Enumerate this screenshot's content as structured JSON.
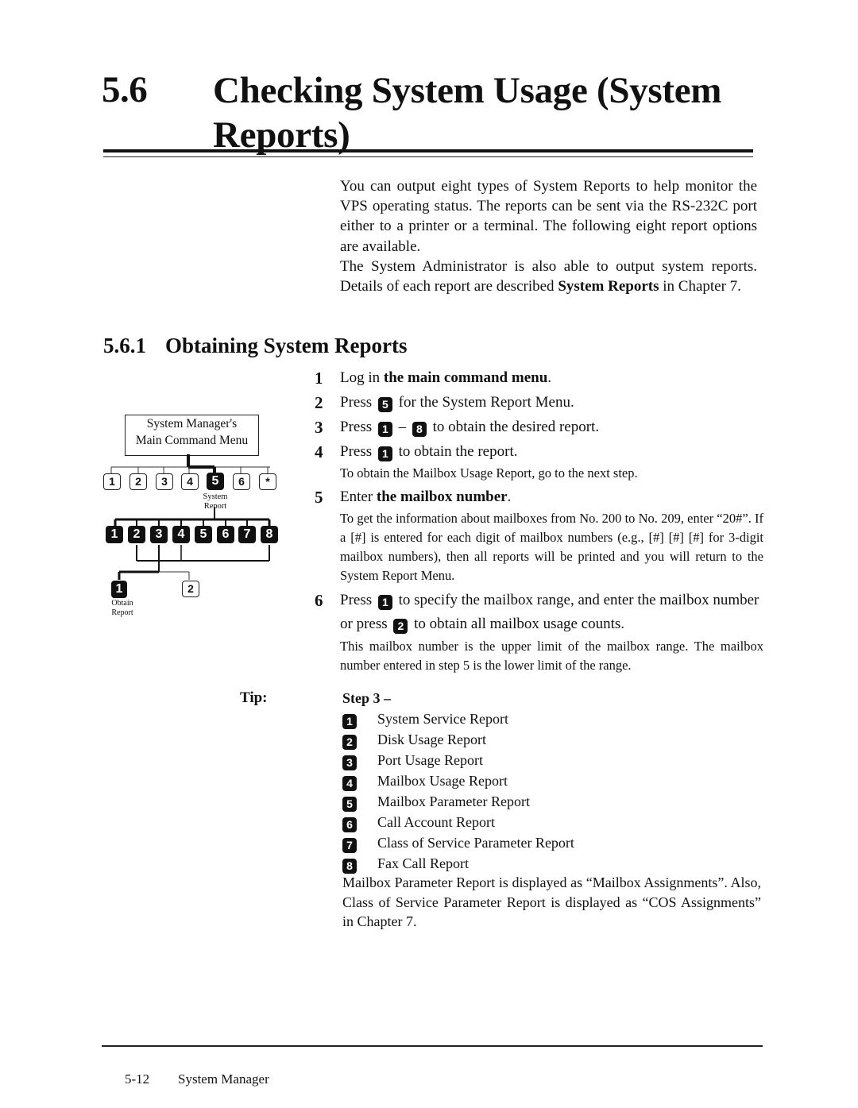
{
  "section": {
    "number": "5.6",
    "title": "Checking System Usage (System Reports)"
  },
  "intro": {
    "p1": "You can output eight types of System Reports to help monitor the VPS operating status. The reports can be sent via the RS-232C port either to a printer or a terminal. The following eight report options are available.",
    "p2_pre": "The System Administrator is also able to output system reports. Details of each report are described ",
    "p2_bold": "System Reports",
    "p2_post": " in Chapter 7."
  },
  "subsection": {
    "number": "5.6.1",
    "title": "Obtaining System Reports"
  },
  "diagram": {
    "menu_box": [
      "System Manager's",
      "Main Command Menu"
    ],
    "top_keys": [
      "1",
      "2",
      "3",
      "4",
      "5",
      "6",
      "*"
    ],
    "selected_top_key": "5",
    "system_report_label": [
      "System",
      "Report"
    ],
    "report_keys": [
      "1",
      "2",
      "3",
      "4",
      "5",
      "6",
      "7",
      "8"
    ],
    "sub_keys": [
      "1",
      "2"
    ],
    "obtain_label": [
      "Obtain",
      "Report"
    ]
  },
  "steps": [
    {
      "n": "1",
      "pre": "Log in ",
      "bold": "the main command menu",
      "post": "."
    },
    {
      "n": "2",
      "pre": "Press",
      "key": "5",
      "post": "for the System Report Menu."
    },
    {
      "n": "3",
      "pre": "Press",
      "key": "1",
      "mid": "–",
      "key2": "8",
      "post": "to obtain the desired report."
    },
    {
      "n": "4",
      "pre": "Press",
      "key": "1",
      "post": "to obtain the report.",
      "note": "To obtain the Mailbox Usage Report, go to the next step."
    },
    {
      "n": "5",
      "pre": "Enter ",
      "bold": "the mailbox number",
      "post": ".",
      "note": "To get the information about mailboxes from No. 200 to No. 209, enter “20#”. If a [#] is entered for each digit of mailbox numbers (e.g., [#] [#] [#] for 3-digit mailbox numbers), then all reports will be printed and you will return to the System Report Menu."
    },
    {
      "n": "6",
      "pre": "Press",
      "key": "1",
      "mid": "to specify the mailbox range, and enter the mailbox number or press",
      "key2": "2",
      "post": "to obtain all mailbox usage counts.",
      "note": "This mailbox number is the upper limit of the mailbox range. The mailbox number entered in step 5 is the lower limit of the range."
    }
  ],
  "tip": {
    "label": "Tip:",
    "heading": "Step 3 –",
    "items": [
      {
        "key": "1",
        "label": "System Service Report"
      },
      {
        "key": "2",
        "label": "Disk Usage Report"
      },
      {
        "key": "3",
        "label": "Port Usage Report"
      },
      {
        "key": "4",
        "label": "Mailbox Usage Report"
      },
      {
        "key": "5",
        "label": "Mailbox Parameter Report"
      },
      {
        "key": "6",
        "label": "Call Account Report"
      },
      {
        "key": "7",
        "label": "Class of Service Parameter Report"
      },
      {
        "key": "8",
        "label": "Fax Call Report"
      }
    ],
    "closing": "Mailbox Parameter Report is displayed as “Mailbox Assignments”. Also, Class of Service Parameter Report is displayed as “COS Assignments” in Chapter 7."
  },
  "footer": {
    "page": "5-12",
    "title": "System Manager"
  }
}
